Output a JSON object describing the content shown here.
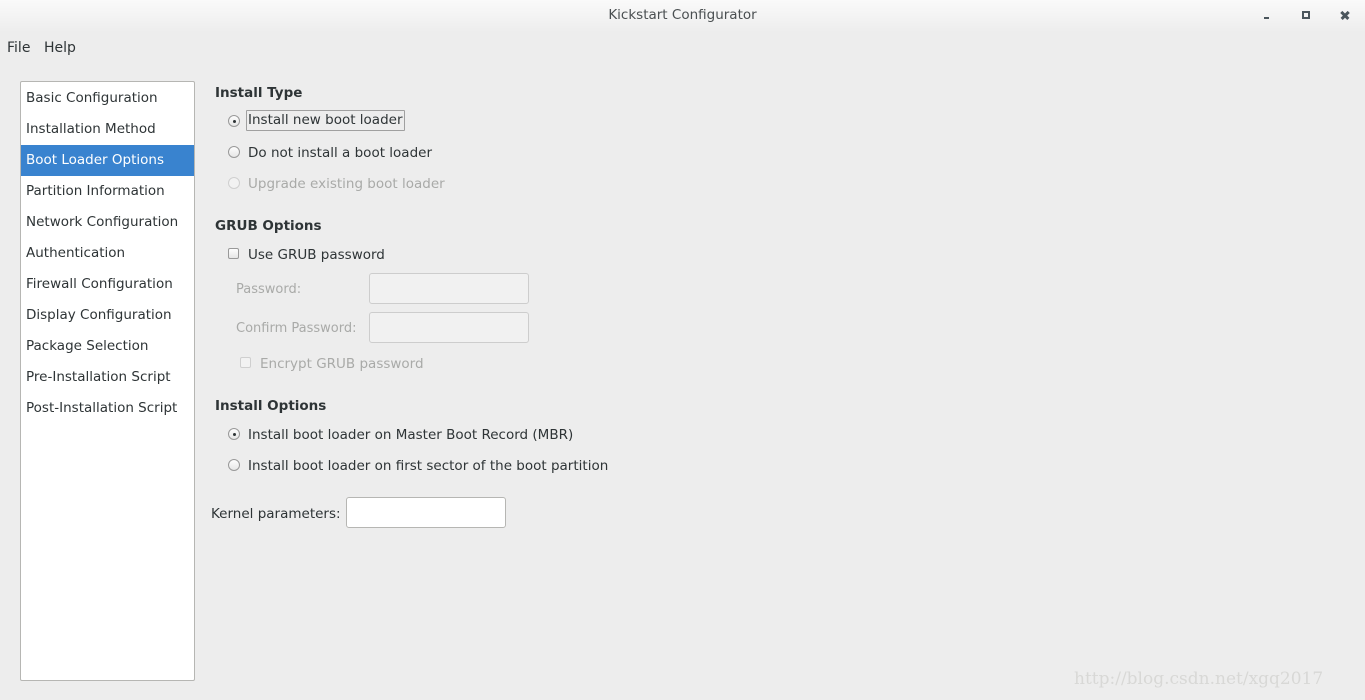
{
  "window": {
    "title": "Kickstart Configurator",
    "controls": [
      "minimize",
      "maximize",
      "close"
    ]
  },
  "menubar": {
    "items": [
      "File",
      "Help"
    ]
  },
  "sidebar": {
    "items": [
      {
        "label": "Basic Configuration",
        "selected": false
      },
      {
        "label": "Installation Method",
        "selected": false
      },
      {
        "label": "Boot Loader Options",
        "selected": true
      },
      {
        "label": "Partition Information",
        "selected": false
      },
      {
        "label": "Network Configuration",
        "selected": false
      },
      {
        "label": "Authentication",
        "selected": false
      },
      {
        "label": "Firewall Configuration",
        "selected": false
      },
      {
        "label": "Display Configuration",
        "selected": false
      },
      {
        "label": "Package Selection",
        "selected": false
      },
      {
        "label": "Pre-Installation Script",
        "selected": false
      },
      {
        "label": "Post-Installation Script",
        "selected": false
      }
    ],
    "selected_color": "#3983cf"
  },
  "install_type": {
    "title": "Install Type",
    "options": [
      {
        "label": "Install new boot loader",
        "checked": true,
        "enabled": true
      },
      {
        "label": "Do not install a boot loader",
        "checked": false,
        "enabled": true
      },
      {
        "label": "Upgrade existing boot loader",
        "checked": false,
        "enabled": false
      }
    ]
  },
  "grub_options": {
    "title": "GRUB Options",
    "use_password": {
      "label": "Use GRUB password",
      "checked": false
    },
    "password": {
      "label": "Password:",
      "value": "",
      "enabled": false
    },
    "confirm_password": {
      "label": "Confirm Password:",
      "value": "",
      "enabled": false
    },
    "encrypt": {
      "label": "Encrypt GRUB password",
      "checked": false,
      "enabled": false
    }
  },
  "install_options": {
    "title": "Install Options",
    "options": [
      {
        "label": "Install boot loader on Master Boot Record (MBR)",
        "checked": true
      },
      {
        "label": "Install boot loader on first sector of the boot partition",
        "checked": false
      }
    ]
  },
  "kernel": {
    "label": "Kernel parameters:",
    "value": ""
  },
  "watermark": "http://blog.csdn.net/xgq2017"
}
